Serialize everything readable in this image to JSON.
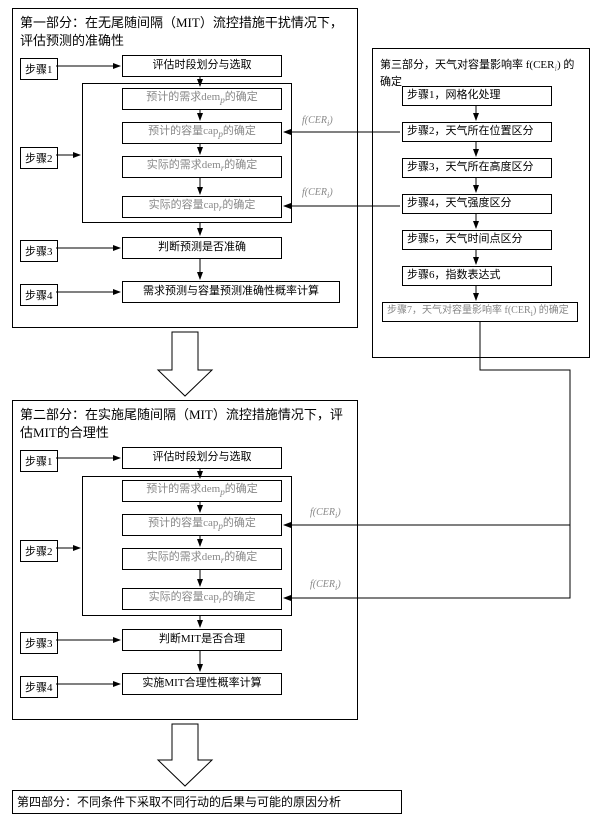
{
  "part1": {
    "title": "第一部分：在无尾随间隔（MIT）流控措施干扰情况下，评估预测的准确性",
    "step1": "步骤1",
    "step2": "步骤2",
    "step3": "步骤3",
    "step4": "步骤4",
    "b1": "评估时段划分与选取",
    "b2a": "预计的需求dem",
    "b2ap": "p",
    "b2a2": "的确定",
    "b2b": "预计的容量cap",
    "b2bp": "p",
    "b2b2": "的确定",
    "b2c": "实际的需求dem",
    "b2cp": "r",
    "b2c2": "的确定",
    "b2d": "实际的容量cap",
    "b2dp": "r",
    "b2d2": "的确定",
    "b3": "判断预测是否准确",
    "b4": "需求预测与容量预测准确性概率计算",
    "f1": "f(CER",
    "f1s": "i",
    "f1e": ")",
    "f2": "f(CER",
    "f2s": "i",
    "f2e": ")"
  },
  "part2": {
    "title": "第二部分：在实施尾随间隔（MIT）流控措施情况下，评估MIT的合理性",
    "step1": "步骤1",
    "step2": "步骤2",
    "step3": "步骤3",
    "step4": "步骤4",
    "b1": "评估时段划分与选取",
    "b2a": "预计的需求dem",
    "b2ap": "p",
    "b2a2": "的确定",
    "b2b": "预计的容量cap",
    "b2bp": "p",
    "b2b2": "的确定",
    "b2c": "实际的需求dem",
    "b2cp": "r",
    "b2c2": "的确定",
    "b2d": "实际的容量cap",
    "b2dp": "r",
    "b2d2": "的确定",
    "b3": "判断MIT是否合理",
    "b4": "实施MIT合理性概率计算",
    "f1": "f(CER",
    "f1s": "i",
    "f1e": ")",
    "f2": "f(CER",
    "f2s": "i",
    "f2e": ")"
  },
  "part3": {
    "title": "第三部分，天气对容量影响率 f(CER",
    "titles": "i",
    "title2": ") 的确定",
    "s1": "步骤1，网格化处理",
    "s2": "步骤2，天气所在位置区分",
    "s3": "步骤3，天气所在高度区分",
    "s4": "步骤4，天气强度区分",
    "s5": "步骤5，天气时间点区分",
    "s6": "步骤6，指数表达式",
    "s7": "步骤7，天气对容量影响率 f(CER",
    "s7s": "i",
    "s7e": ") 的确定"
  },
  "part4": {
    "title": "第四部分：不同条件下采取不同行动的后果与可能的原因分析"
  }
}
